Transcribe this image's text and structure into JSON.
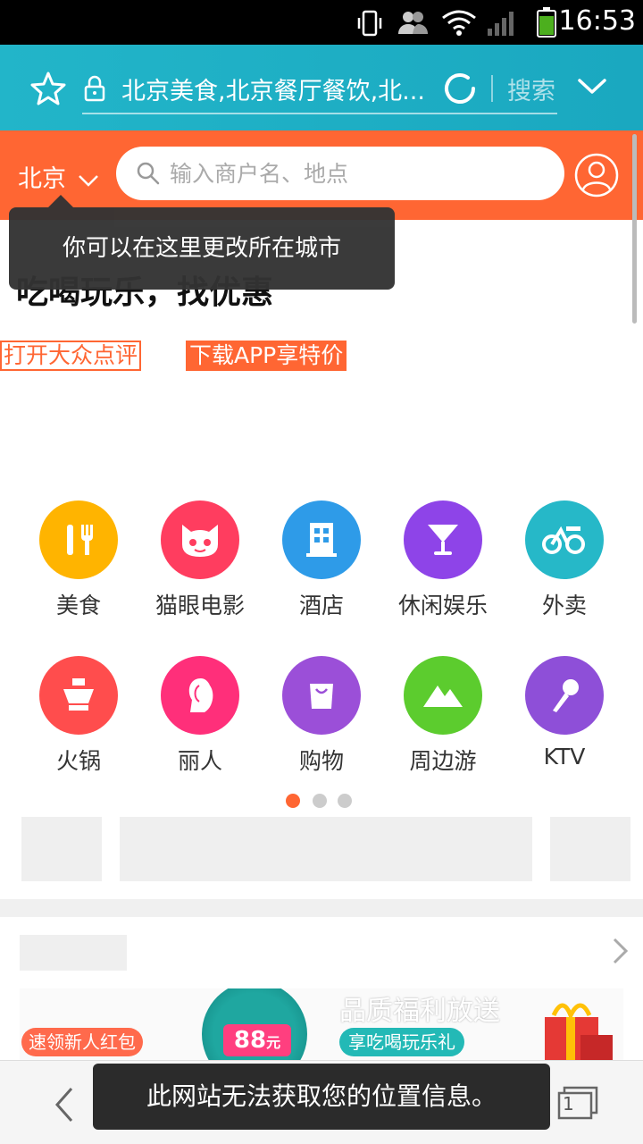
{
  "status_bar": {
    "time": "16:53",
    "icons": [
      "vibrate-icon",
      "users-icon",
      "wifi-icon",
      "signal-icon",
      "battery-icon"
    ]
  },
  "browser": {
    "url_text": "北京美食,北京餐厅餐饮,北...",
    "search_label": "搜索",
    "icons": [
      "star-icon",
      "lock-icon",
      "refresh-icon",
      "chevron-down-icon"
    ]
  },
  "header": {
    "city": "北京",
    "search_placeholder": "输入商户名、地点",
    "icons": [
      "search-icon",
      "user-icon"
    ]
  },
  "tooltip": {
    "text": "你可以在这里更改所在城市"
  },
  "main": {
    "slogan": "吃喝玩乐，找优惠",
    "open_button": "打开大众点评",
    "download_button": "下载APP享特价"
  },
  "categories": [
    {
      "label": "美食",
      "icon": "fork-knife-icon",
      "color": "#ffb400"
    },
    {
      "label": "猫眼电影",
      "icon": "cat-icon",
      "color": "#ff3d5f"
    },
    {
      "label": "酒店",
      "icon": "hotel-icon",
      "color": "#2e9be8"
    },
    {
      "label": "休闲娱乐",
      "icon": "cocktail-icon",
      "color": "#8e44e8"
    },
    {
      "label": "外卖",
      "icon": "delivery-icon",
      "color": "#26b8c8"
    },
    {
      "label": "火锅",
      "icon": "hotpot-icon",
      "color": "#ff4d4d"
    },
    {
      "label": "丽人",
      "icon": "woman-icon",
      "color": "#ff2f7a"
    },
    {
      "label": "购物",
      "icon": "shopping-bag-icon",
      "color": "#9b4fd8"
    },
    {
      "label": "周边游",
      "icon": "mountain-icon",
      "color": "#5ccc2e"
    },
    {
      "label": "KTV",
      "icon": "microphone-icon",
      "color": "#8e4fd8"
    }
  ],
  "pager": {
    "active": 0,
    "count": 3
  },
  "promo": {
    "red_packet": "速领新人红包",
    "coin_value": "88",
    "coin_unit": "元",
    "quality_text": "品质福利放送",
    "enjoy_text": "享吃喝玩乐礼"
  },
  "toast": {
    "text": "此网站无法获取您的位置信息。"
  },
  "nav": {
    "tab_count": "1",
    "icons": [
      "back-arrow-icon",
      "tabs-icon"
    ]
  },
  "colors": {
    "browser_bar": "#1fb0c6",
    "header": "#ff6633",
    "accent": "#ff6633"
  }
}
